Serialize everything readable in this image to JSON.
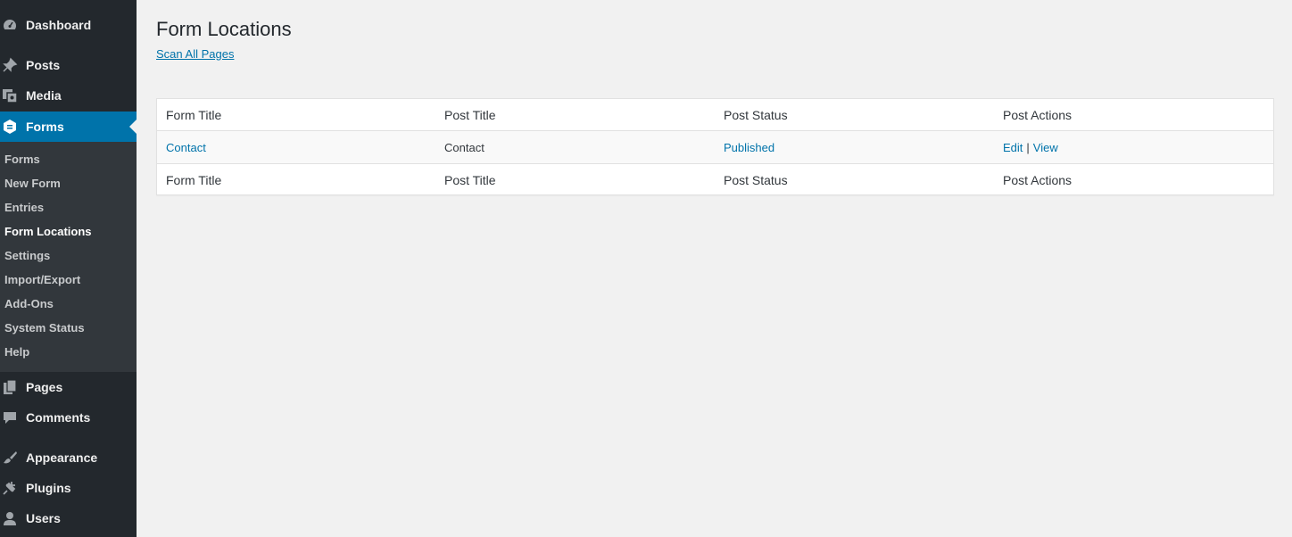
{
  "sidebar": {
    "items": [
      {
        "label": "Dashboard",
        "icon": "dashboard-icon"
      },
      {
        "label": "Posts",
        "icon": "pin-icon"
      },
      {
        "label": "Media",
        "icon": "media-icon"
      },
      {
        "label": "Forms",
        "icon": "forms-icon"
      },
      {
        "label": "Pages",
        "icon": "pages-icon"
      },
      {
        "label": "Comments",
        "icon": "comment-icon"
      },
      {
        "label": "Appearance",
        "icon": "brush-icon"
      },
      {
        "label": "Plugins",
        "icon": "plug-icon"
      },
      {
        "label": "Users",
        "icon": "user-icon"
      }
    ],
    "submenu": [
      "Forms",
      "New Form",
      "Entries",
      "Form Locations",
      "Settings",
      "Import/Export",
      "Add-Ons",
      "System Status",
      "Help"
    ],
    "accent_color": "#0073aa"
  },
  "main": {
    "title": "Form Locations",
    "scan_link": "Scan All Pages",
    "table": {
      "headers": [
        "Form Title",
        "Post Title",
        "Post Status",
        "Post Actions"
      ],
      "rows": [
        {
          "form_title": "Contact",
          "post_title": "Contact",
          "post_status": "Published",
          "edit": "Edit",
          "sep": "|",
          "view": "View"
        }
      ]
    }
  }
}
